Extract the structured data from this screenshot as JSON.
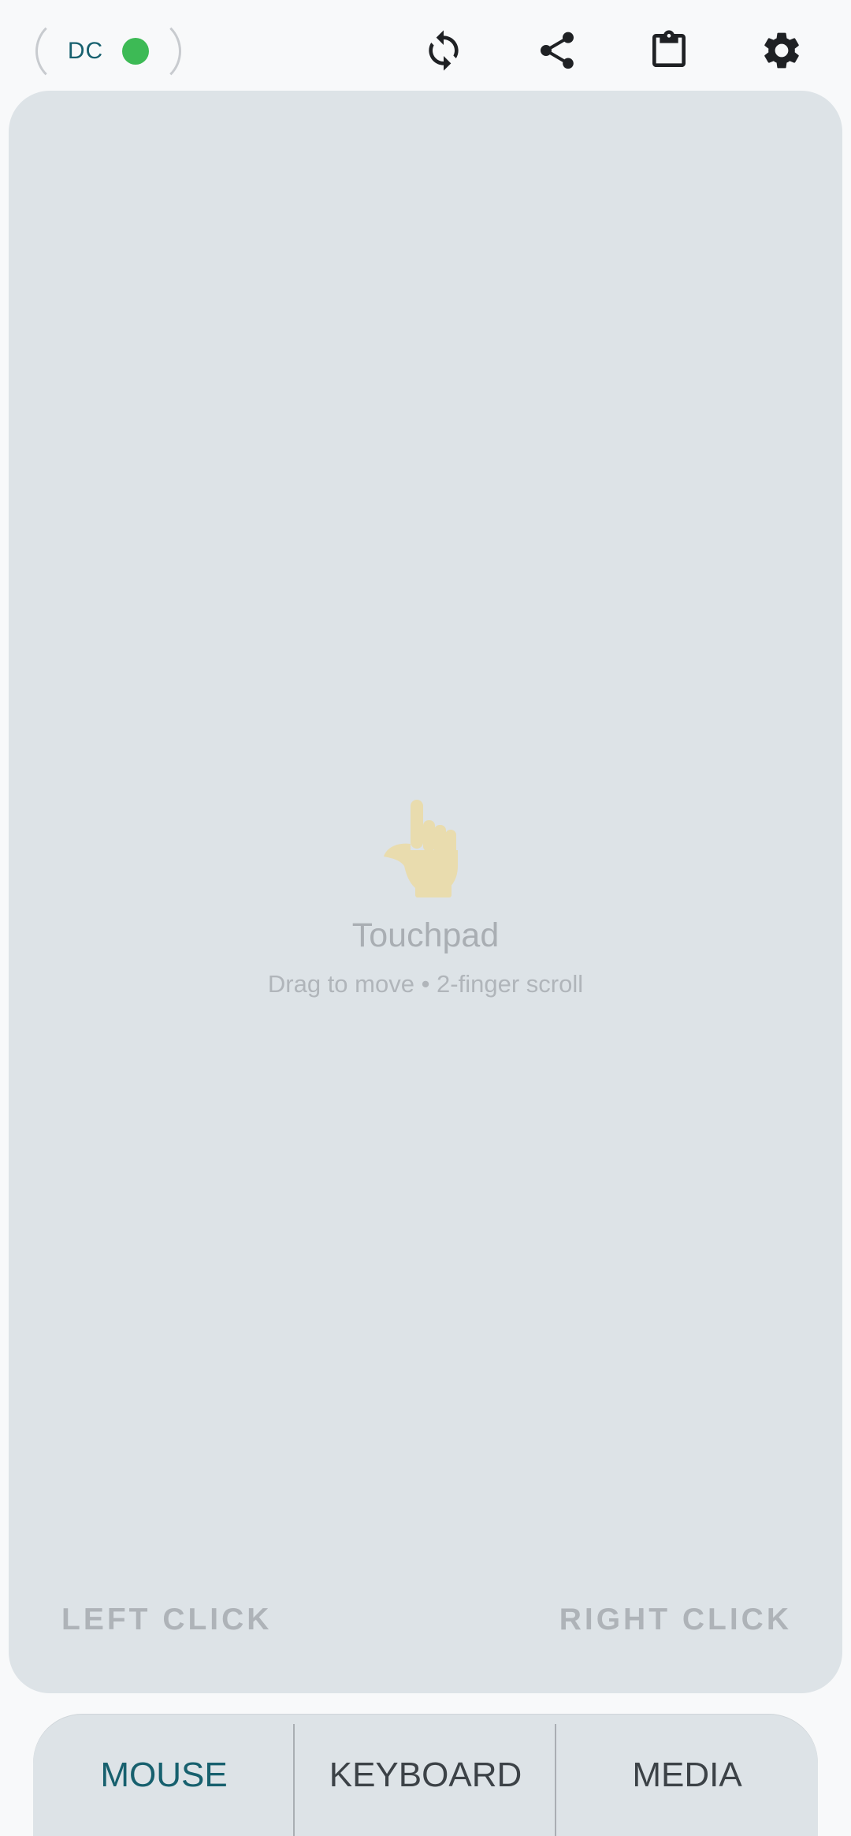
{
  "header": {
    "connection_label": "DC",
    "status_color": "#3dba55",
    "icons": [
      "sync-icon",
      "share-icon",
      "clipboard-icon",
      "gear-icon"
    ]
  },
  "touchpad": {
    "title": "Touchpad",
    "subtitle": "Drag to move • 2-finger scroll",
    "left_click": "LEFT CLICK",
    "right_click": "RIGHT CLICK"
  },
  "tabs": [
    {
      "label": "MOUSE",
      "active": true
    },
    {
      "label": "KEYBOARD",
      "active": false
    },
    {
      "label": "MEDIA",
      "active": false
    }
  ]
}
